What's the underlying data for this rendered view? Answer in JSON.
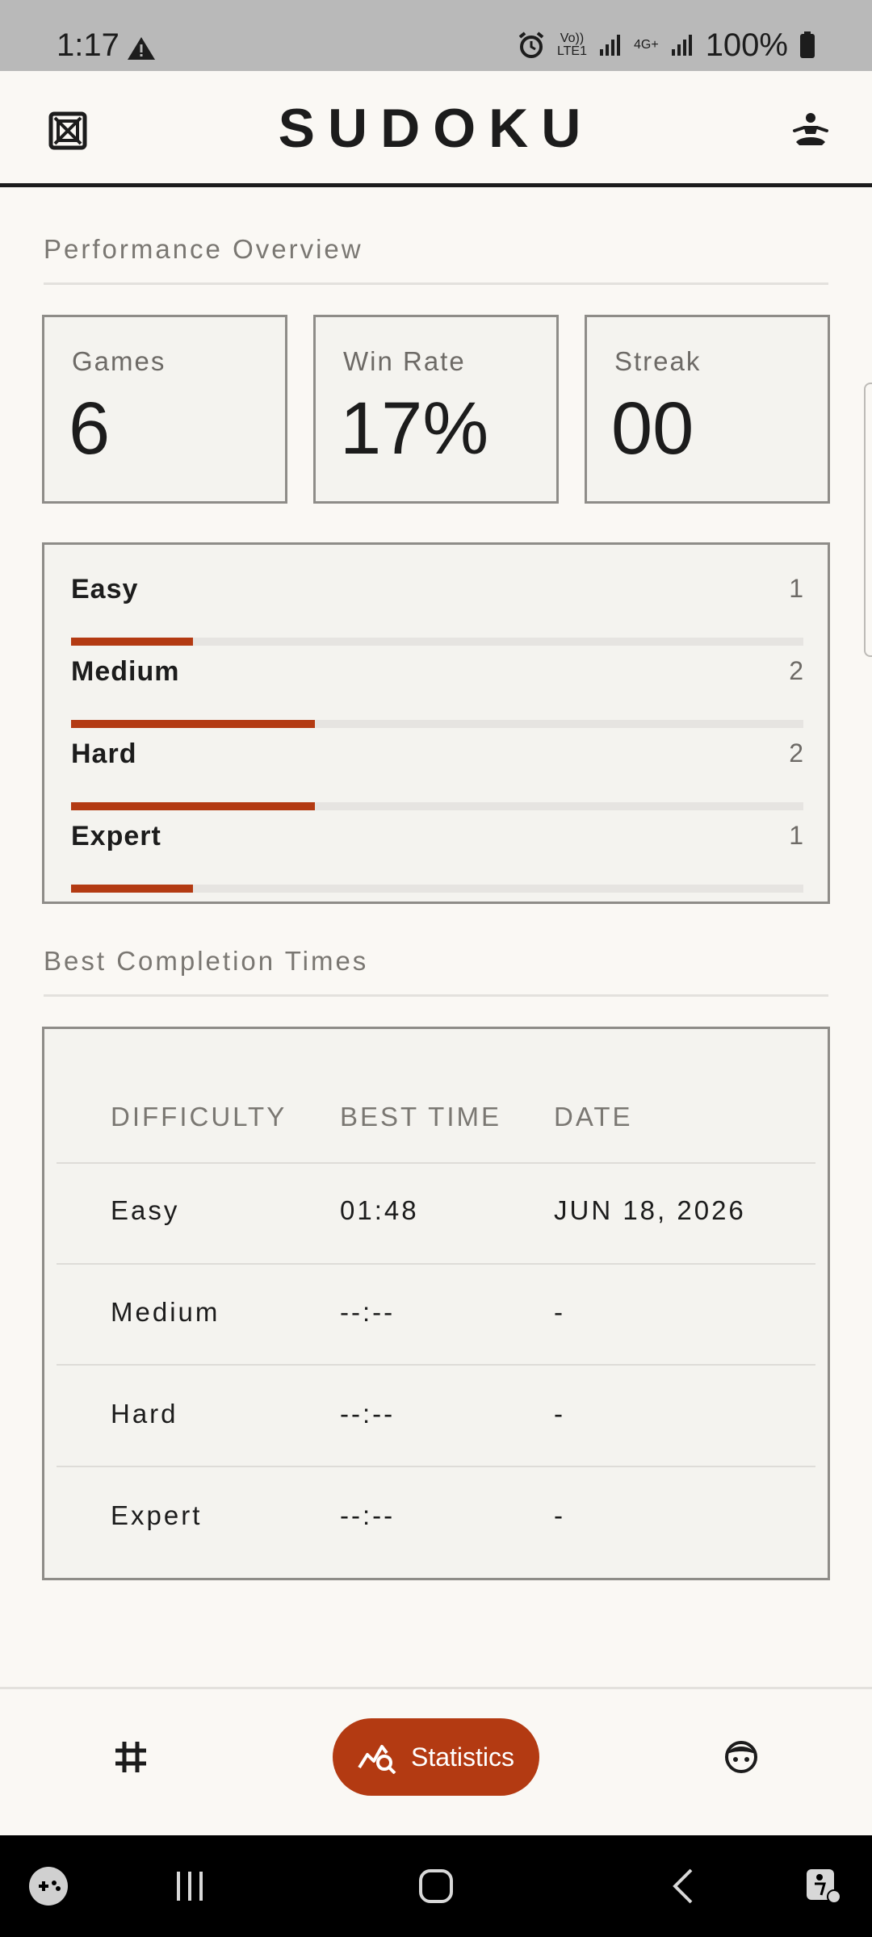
{
  "status_bar": {
    "time": "1:17",
    "volte_label": "Vo))\nLTE1",
    "net_label": "4G+",
    "battery": "100%"
  },
  "header": {
    "title": "SUDOKU",
    "left_icon": "grid-x-icon",
    "right_icon": "meditation-icon"
  },
  "overview": {
    "title": "Performance Overview",
    "cards": [
      {
        "label": "Games",
        "value": "6"
      },
      {
        "label": "Win Rate",
        "value": "17%"
      },
      {
        "label": "Streak",
        "value": "00"
      }
    ]
  },
  "difficulty_breakdown": [
    {
      "name": "Easy",
      "count": "1",
      "fraction": 0.1667
    },
    {
      "name": "Medium",
      "count": "2",
      "fraction": 0.3333
    },
    {
      "name": "Hard",
      "count": "2",
      "fraction": 0.3333
    },
    {
      "name": "Expert",
      "count": "1",
      "fraction": 0.1667
    }
  ],
  "best_times": {
    "title": "Best Completion Times",
    "headers": [
      "DIFFICULTY",
      "BEST TIME",
      "DATE"
    ],
    "rows": [
      {
        "difficulty": "Easy",
        "time": "01:48",
        "date": "JUN 18, 2026"
      },
      {
        "difficulty": "Medium",
        "time": "--:--",
        "date": "-"
      },
      {
        "difficulty": "Hard",
        "time": "--:--",
        "date": "-"
      },
      {
        "difficulty": "Expert",
        "time": "--:--",
        "date": "-"
      }
    ]
  },
  "bottom_nav": {
    "left_icon": "grid-icon",
    "active_label": "Statistics",
    "active_icon": "chart-search-icon",
    "right_icon": "face-icon"
  },
  "colors": {
    "accent": "#b33a12",
    "background": "#faf8f4",
    "card": "#f4f3ef"
  }
}
